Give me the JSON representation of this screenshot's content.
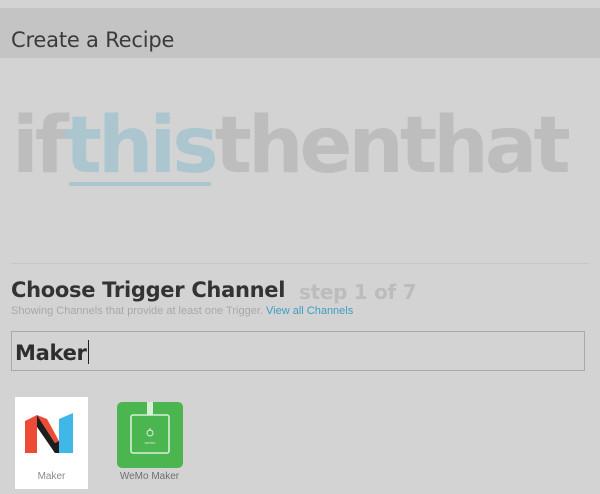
{
  "header": {
    "title": "Create a Recipe"
  },
  "headline": {
    "if": "if",
    "this": "this",
    "then": "then",
    "that": "that"
  },
  "trigger": {
    "title": "Choose Trigger Channel",
    "step": "step 1 of 7",
    "helper_text": "Showing Channels that provide at least one Trigger.",
    "helper_link": "View all Channels"
  },
  "search": {
    "value": "Maker"
  },
  "channels": [
    {
      "label": "Maker",
      "icon": "maker-logo-icon"
    },
    {
      "label": "WeMo Maker",
      "icon": "wemo-maker-icon",
      "icon_text": "wemo"
    }
  ],
  "colors": {
    "background": "#d3d3d3",
    "header": "#c4c4c4",
    "link": "#3d9fc2",
    "this_highlight": "#abc6cf",
    "wemo_green": "#4bb54f",
    "maker_red": "#ee4b36",
    "maker_blue": "#40b7e9"
  }
}
